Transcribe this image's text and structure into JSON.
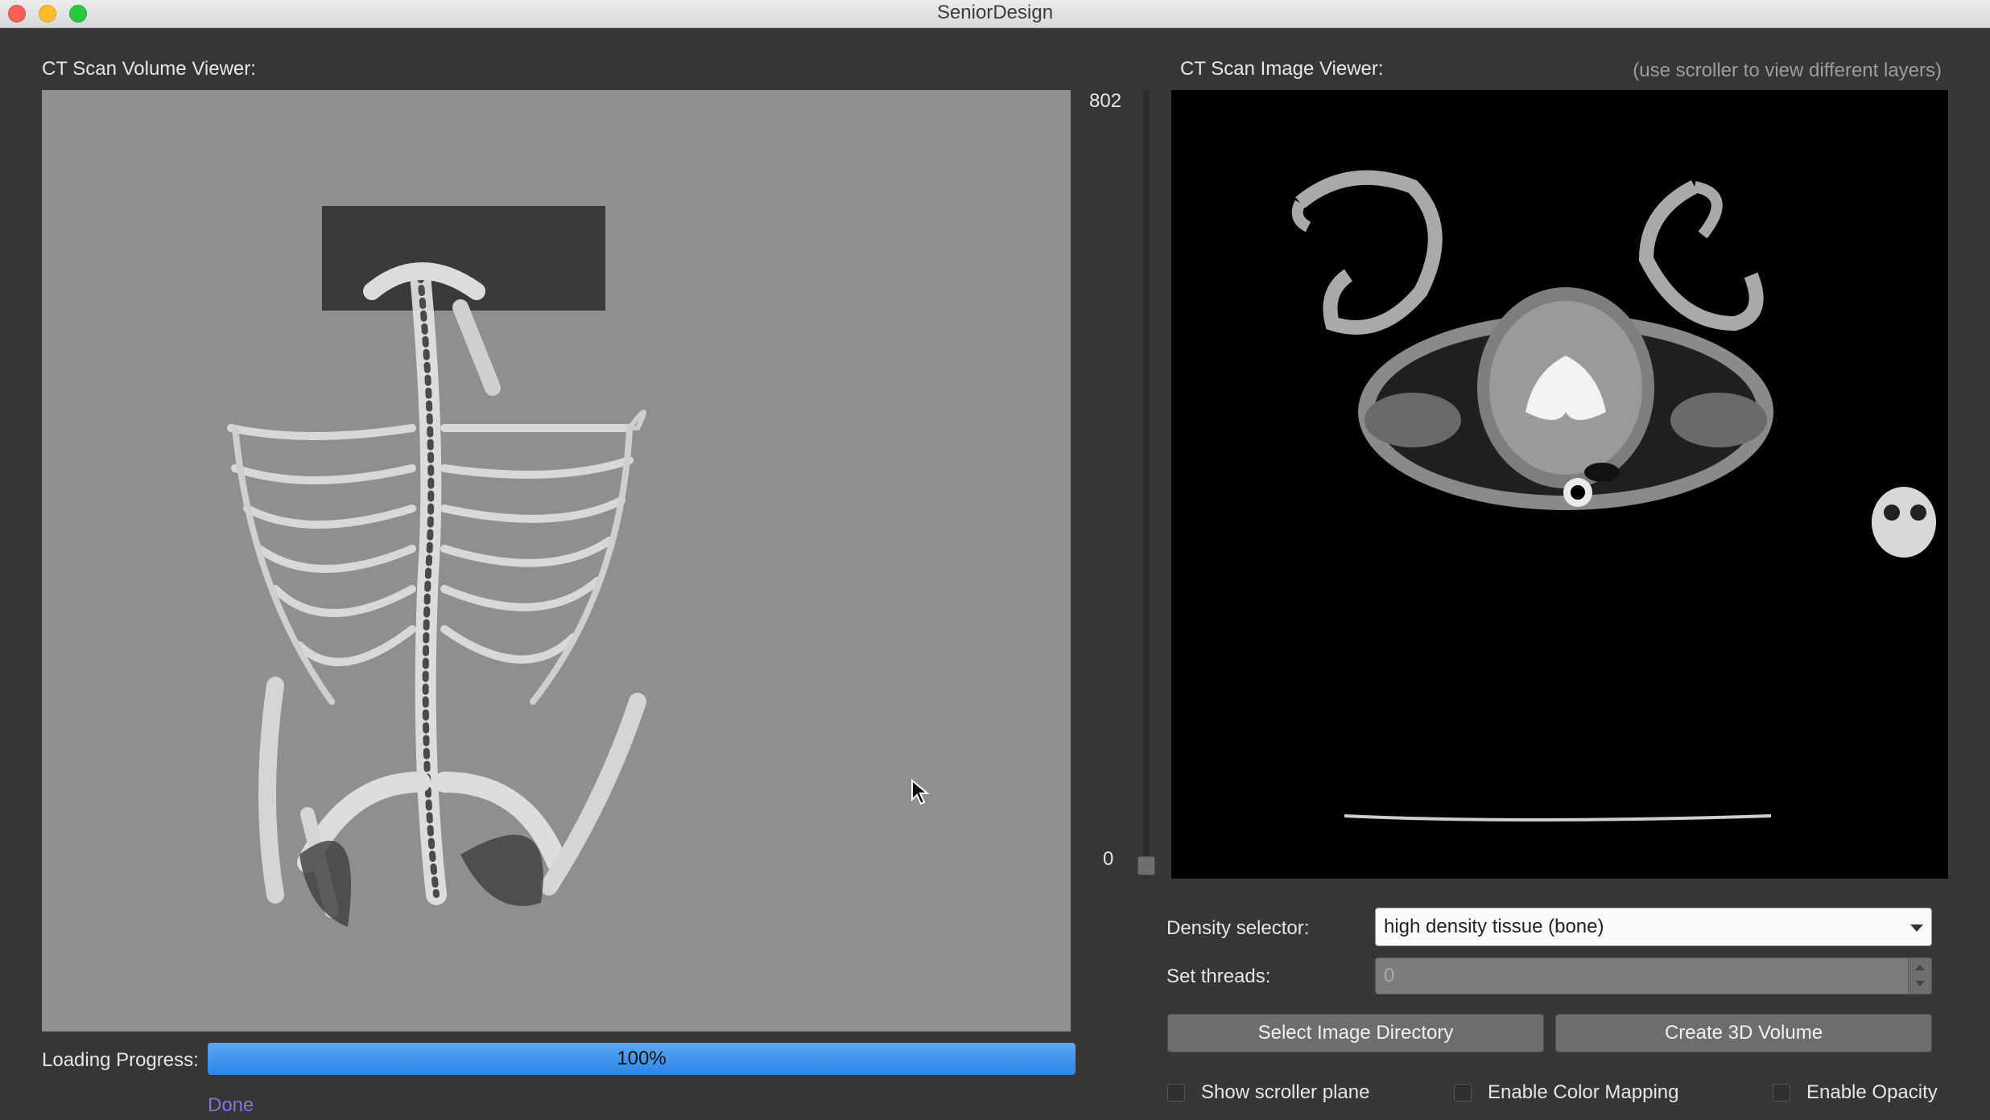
{
  "window": {
    "title": "SeniorDesign"
  },
  "volume_viewer": {
    "label": "CT Scan Volume Viewer:"
  },
  "image_viewer": {
    "label": "CT Scan Image Viewer:",
    "hint": "(use scroller to view different layers)"
  },
  "layer_slider": {
    "max_label": "802",
    "min_label": "0",
    "value": 0
  },
  "loading": {
    "label": "Loading Progress:",
    "progress_text": "100%",
    "progress": 1.0,
    "status": "Done"
  },
  "density": {
    "label": "Density selector:",
    "selected": "high density tissue (bone)"
  },
  "threads": {
    "label": "Set threads:",
    "value": "0"
  },
  "buttons": {
    "select_dir": "Select Image Directory",
    "create_volume": "Create 3D Volume"
  },
  "checkboxes": {
    "scroller_plane": "Show scroller plane",
    "color_mapping": "Enable Color Mapping",
    "opacity": "Enable Opacity"
  },
  "colors": {
    "accent": "#3b8eea",
    "done_link": "#8a6fd8"
  },
  "icons": [
    "close-icon",
    "minimize-icon",
    "zoom-icon",
    "chevron-down-icon",
    "cursor-icon"
  ]
}
